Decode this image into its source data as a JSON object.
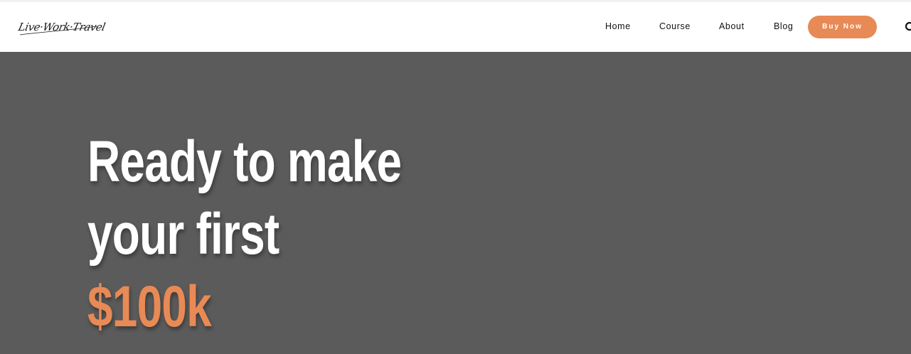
{
  "brand": {
    "logo_text": "Live·Work·Travel"
  },
  "nav": {
    "items": [
      {
        "label": "Home"
      },
      {
        "label": "Course"
      },
      {
        "label": "About"
      },
      {
        "label": "Blog"
      }
    ],
    "cta_label": "Buy Now",
    "search_icon": "search-icon"
  },
  "hero": {
    "line1": "Ready to make",
    "line2": "your first",
    "line3": "$100k"
  },
  "colors": {
    "accent": "#e88a55",
    "hero_bg": "#5b5b5b",
    "header_bg": "#ffffff"
  }
}
